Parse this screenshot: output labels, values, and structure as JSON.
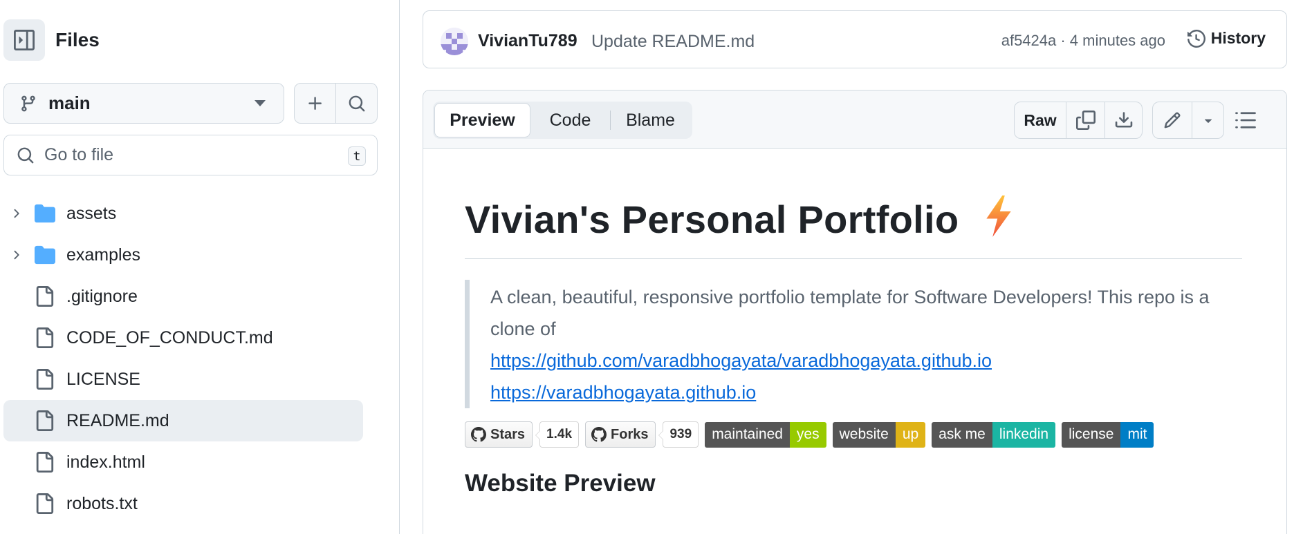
{
  "sidebar": {
    "title": "Files",
    "branch": "main",
    "search_placeholder": "Go to file",
    "search_shortcut": "t",
    "tree": [
      {
        "name": "assets",
        "type": "folder"
      },
      {
        "name": "examples",
        "type": "folder"
      },
      {
        "name": ".gitignore",
        "type": "file"
      },
      {
        "name": "CODE_OF_CONDUCT.md",
        "type": "file"
      },
      {
        "name": "LICENSE",
        "type": "file"
      },
      {
        "name": "README.md",
        "type": "file",
        "selected": true
      },
      {
        "name": "index.html",
        "type": "file"
      },
      {
        "name": "robots.txt",
        "type": "file"
      }
    ]
  },
  "commit": {
    "author": "VivianTu789",
    "message": "Update README.md",
    "meta": "af5424a · 4 minutes ago",
    "history_label": "History"
  },
  "viewer": {
    "tabs": [
      "Preview",
      "Code",
      "Blame"
    ],
    "active_tab": "Preview",
    "raw_label": "Raw"
  },
  "readme": {
    "title": "Vivian's Personal Portfolio",
    "title_emoji": "lightning-bolt-icon",
    "quote_text": "A clean, beautiful, responsive portfolio template for Software Developers! This repo is a clone of",
    "links": [
      "https://github.com/varadbhogayata/varadbhogayata.github.io",
      "https://varadbhogayata.github.io"
    ],
    "badges": {
      "stars_label": "Stars",
      "stars_count": "1.4k",
      "forks_label": "Forks",
      "forks_count": "939",
      "shields": [
        {
          "left": "maintained",
          "right": "yes",
          "color": "#97ca00"
        },
        {
          "left": "website",
          "right": "up",
          "color": "#dfb317"
        },
        {
          "left": "ask me",
          "right": "linkedin",
          "color": "#1bb5a3"
        },
        {
          "left": "license",
          "right": "mit",
          "color": "#007ec6"
        }
      ]
    },
    "section_heading": "Website Preview"
  },
  "colors": {
    "accent_link": "#0969da",
    "folder": "#54aeff",
    "border": "#d1d9e0",
    "muted": "#59636e"
  }
}
